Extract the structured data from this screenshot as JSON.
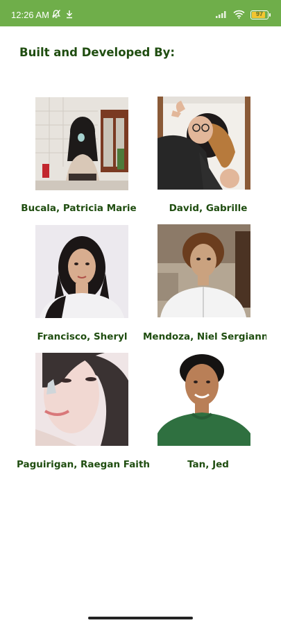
{
  "status_bar": {
    "time": "12:26 AM",
    "battery": "97",
    "icons": [
      "bell-off-icon",
      "download-icon",
      "signal-icon",
      "wifi-icon",
      "battery-icon"
    ]
  },
  "page": {
    "title": "Built and Developed By:"
  },
  "team": [
    {
      "name": "Bucala, Patricia Marie"
    },
    {
      "name": "David, Gabrille"
    },
    {
      "name": "Francisco, Sheryl"
    },
    {
      "name": "Mendoza, Niel Sergianne"
    },
    {
      "name": "Paguirigan, Raegan Faith"
    },
    {
      "name": "Tan, Jed"
    }
  ],
  "colors": {
    "status_bar": "#6fae4a",
    "accent_text": "#1f4d10",
    "background": "#ffffff"
  }
}
